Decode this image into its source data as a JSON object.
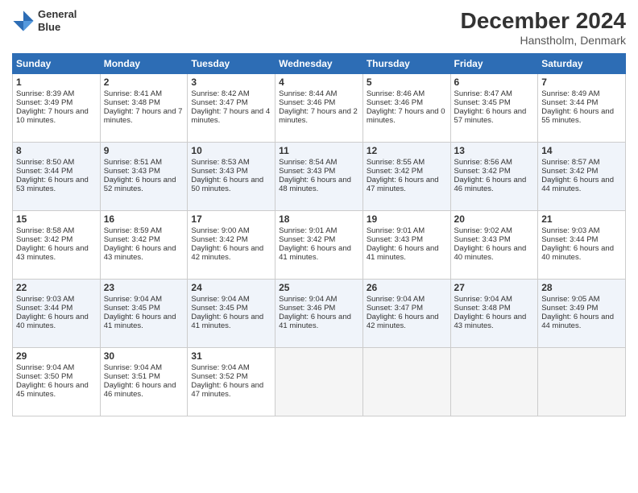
{
  "header": {
    "logo_line1": "General",
    "logo_line2": "Blue",
    "month": "December 2024",
    "location": "Hanstholm, Denmark"
  },
  "days_of_week": [
    "Sunday",
    "Monday",
    "Tuesday",
    "Wednesday",
    "Thursday",
    "Friday",
    "Saturday"
  ],
  "weeks": [
    [
      {
        "day": "1",
        "rise": "Sunrise: 8:39 AM",
        "set": "Sunset: 3:49 PM",
        "daylight": "Daylight: 7 hours and 10 minutes."
      },
      {
        "day": "2",
        "rise": "Sunrise: 8:41 AM",
        "set": "Sunset: 3:48 PM",
        "daylight": "Daylight: 7 hours and 7 minutes."
      },
      {
        "day": "3",
        "rise": "Sunrise: 8:42 AM",
        "set": "Sunset: 3:47 PM",
        "daylight": "Daylight: 7 hours and 4 minutes."
      },
      {
        "day": "4",
        "rise": "Sunrise: 8:44 AM",
        "set": "Sunset: 3:46 PM",
        "daylight": "Daylight: 7 hours and 2 minutes."
      },
      {
        "day": "5",
        "rise": "Sunrise: 8:46 AM",
        "set": "Sunset: 3:46 PM",
        "daylight": "Daylight: 7 hours and 0 minutes."
      },
      {
        "day": "6",
        "rise": "Sunrise: 8:47 AM",
        "set": "Sunset: 3:45 PM",
        "daylight": "Daylight: 6 hours and 57 minutes."
      },
      {
        "day": "7",
        "rise": "Sunrise: 8:49 AM",
        "set": "Sunset: 3:44 PM",
        "daylight": "Daylight: 6 hours and 55 minutes."
      }
    ],
    [
      {
        "day": "8",
        "rise": "Sunrise: 8:50 AM",
        "set": "Sunset: 3:44 PM",
        "daylight": "Daylight: 6 hours and 53 minutes."
      },
      {
        "day": "9",
        "rise": "Sunrise: 8:51 AM",
        "set": "Sunset: 3:43 PM",
        "daylight": "Daylight: 6 hours and 52 minutes."
      },
      {
        "day": "10",
        "rise": "Sunrise: 8:53 AM",
        "set": "Sunset: 3:43 PM",
        "daylight": "Daylight: 6 hours and 50 minutes."
      },
      {
        "day": "11",
        "rise": "Sunrise: 8:54 AM",
        "set": "Sunset: 3:43 PM",
        "daylight": "Daylight: 6 hours and 48 minutes."
      },
      {
        "day": "12",
        "rise": "Sunrise: 8:55 AM",
        "set": "Sunset: 3:42 PM",
        "daylight": "Daylight: 6 hours and 47 minutes."
      },
      {
        "day": "13",
        "rise": "Sunrise: 8:56 AM",
        "set": "Sunset: 3:42 PM",
        "daylight": "Daylight: 6 hours and 46 minutes."
      },
      {
        "day": "14",
        "rise": "Sunrise: 8:57 AM",
        "set": "Sunset: 3:42 PM",
        "daylight": "Daylight: 6 hours and 44 minutes."
      }
    ],
    [
      {
        "day": "15",
        "rise": "Sunrise: 8:58 AM",
        "set": "Sunset: 3:42 PM",
        "daylight": "Daylight: 6 hours and 43 minutes."
      },
      {
        "day": "16",
        "rise": "Sunrise: 8:59 AM",
        "set": "Sunset: 3:42 PM",
        "daylight": "Daylight: 6 hours and 43 minutes."
      },
      {
        "day": "17",
        "rise": "Sunrise: 9:00 AM",
        "set": "Sunset: 3:42 PM",
        "daylight": "Daylight: 6 hours and 42 minutes."
      },
      {
        "day": "18",
        "rise": "Sunrise: 9:01 AM",
        "set": "Sunset: 3:42 PM",
        "daylight": "Daylight: 6 hours and 41 minutes."
      },
      {
        "day": "19",
        "rise": "Sunrise: 9:01 AM",
        "set": "Sunset: 3:43 PM",
        "daylight": "Daylight: 6 hours and 41 minutes."
      },
      {
        "day": "20",
        "rise": "Sunrise: 9:02 AM",
        "set": "Sunset: 3:43 PM",
        "daylight": "Daylight: 6 hours and 40 minutes."
      },
      {
        "day": "21",
        "rise": "Sunrise: 9:03 AM",
        "set": "Sunset: 3:44 PM",
        "daylight": "Daylight: 6 hours and 40 minutes."
      }
    ],
    [
      {
        "day": "22",
        "rise": "Sunrise: 9:03 AM",
        "set": "Sunset: 3:44 PM",
        "daylight": "Daylight: 6 hours and 40 minutes."
      },
      {
        "day": "23",
        "rise": "Sunrise: 9:04 AM",
        "set": "Sunset: 3:45 PM",
        "daylight": "Daylight: 6 hours and 41 minutes."
      },
      {
        "day": "24",
        "rise": "Sunrise: 9:04 AM",
        "set": "Sunset: 3:45 PM",
        "daylight": "Daylight: 6 hours and 41 minutes."
      },
      {
        "day": "25",
        "rise": "Sunrise: 9:04 AM",
        "set": "Sunset: 3:46 PM",
        "daylight": "Daylight: 6 hours and 41 minutes."
      },
      {
        "day": "26",
        "rise": "Sunrise: 9:04 AM",
        "set": "Sunset: 3:47 PM",
        "daylight": "Daylight: 6 hours and 42 minutes."
      },
      {
        "day": "27",
        "rise": "Sunrise: 9:04 AM",
        "set": "Sunset: 3:48 PM",
        "daylight": "Daylight: 6 hours and 43 minutes."
      },
      {
        "day": "28",
        "rise": "Sunrise: 9:05 AM",
        "set": "Sunset: 3:49 PM",
        "daylight": "Daylight: 6 hours and 44 minutes."
      }
    ],
    [
      {
        "day": "29",
        "rise": "Sunrise: 9:04 AM",
        "set": "Sunset: 3:50 PM",
        "daylight": "Daylight: 6 hours and 45 minutes."
      },
      {
        "day": "30",
        "rise": "Sunrise: 9:04 AM",
        "set": "Sunset: 3:51 PM",
        "daylight": "Daylight: 6 hours and 46 minutes."
      },
      {
        "day": "31",
        "rise": "Sunrise: 9:04 AM",
        "set": "Sunset: 3:52 PM",
        "daylight": "Daylight: 6 hours and 47 minutes."
      },
      null,
      null,
      null,
      null
    ]
  ]
}
